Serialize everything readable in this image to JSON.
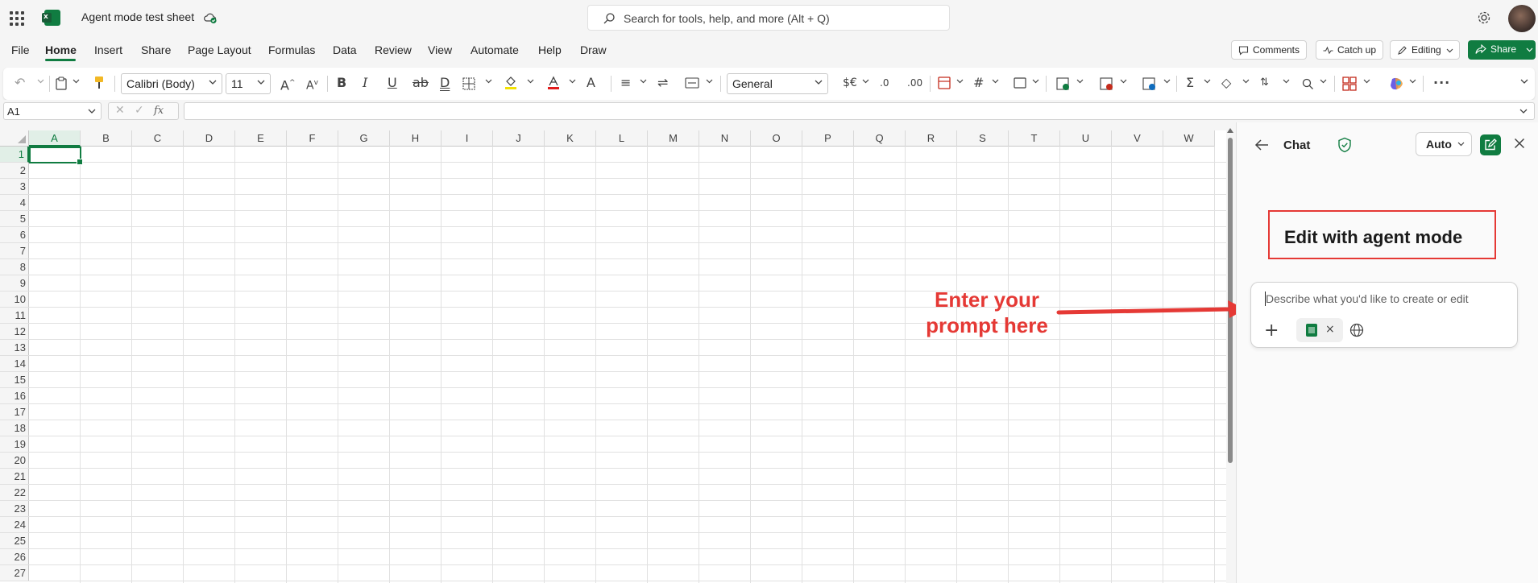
{
  "app": {
    "doc_title": "Agent mode test sheet",
    "search_placeholder": "Search for tools, help, and more (Alt + Q)"
  },
  "ribbon": {
    "tabs": [
      "File",
      "Home",
      "Insert",
      "Share",
      "Page Layout",
      "Formulas",
      "Data",
      "Review",
      "View",
      "Automate",
      "Help",
      "Draw"
    ],
    "active_tab": "Home",
    "comments_label": "Comments",
    "catchup_label": "Catch up",
    "editing_label": "Editing",
    "share_label": "Share"
  },
  "toolbar": {
    "font_name": "Calibri (Body)",
    "font_size": "11",
    "number_format": "General"
  },
  "formula_bar": {
    "name_box": "A1",
    "fx": "fx",
    "formula": ""
  },
  "grid": {
    "columns": [
      "A",
      "B",
      "C",
      "D",
      "E",
      "F",
      "G",
      "H",
      "I",
      "J",
      "K",
      "L",
      "M",
      "N",
      "O",
      "P",
      "Q",
      "R",
      "S",
      "T",
      "U",
      "V",
      "W"
    ],
    "rows": [
      "1",
      "2",
      "3",
      "4",
      "5",
      "6",
      "7",
      "8",
      "9",
      "10",
      "11",
      "12",
      "13",
      "14",
      "15",
      "16",
      "17",
      "18",
      "19",
      "20",
      "21",
      "22",
      "23",
      "24",
      "25",
      "26",
      "27"
    ],
    "selected_cell": "A1"
  },
  "annotation": {
    "line1": "Enter your",
    "line2": "prompt here",
    "color": "#e53935"
  },
  "chat_pane": {
    "title": "Chat",
    "mode_label": "Auto",
    "heading": "Edit with agent mode",
    "prompt_placeholder": "Describe what you'd like to create or edit"
  },
  "colors": {
    "accent": "#107c41",
    "highlight_red": "#e53935"
  }
}
